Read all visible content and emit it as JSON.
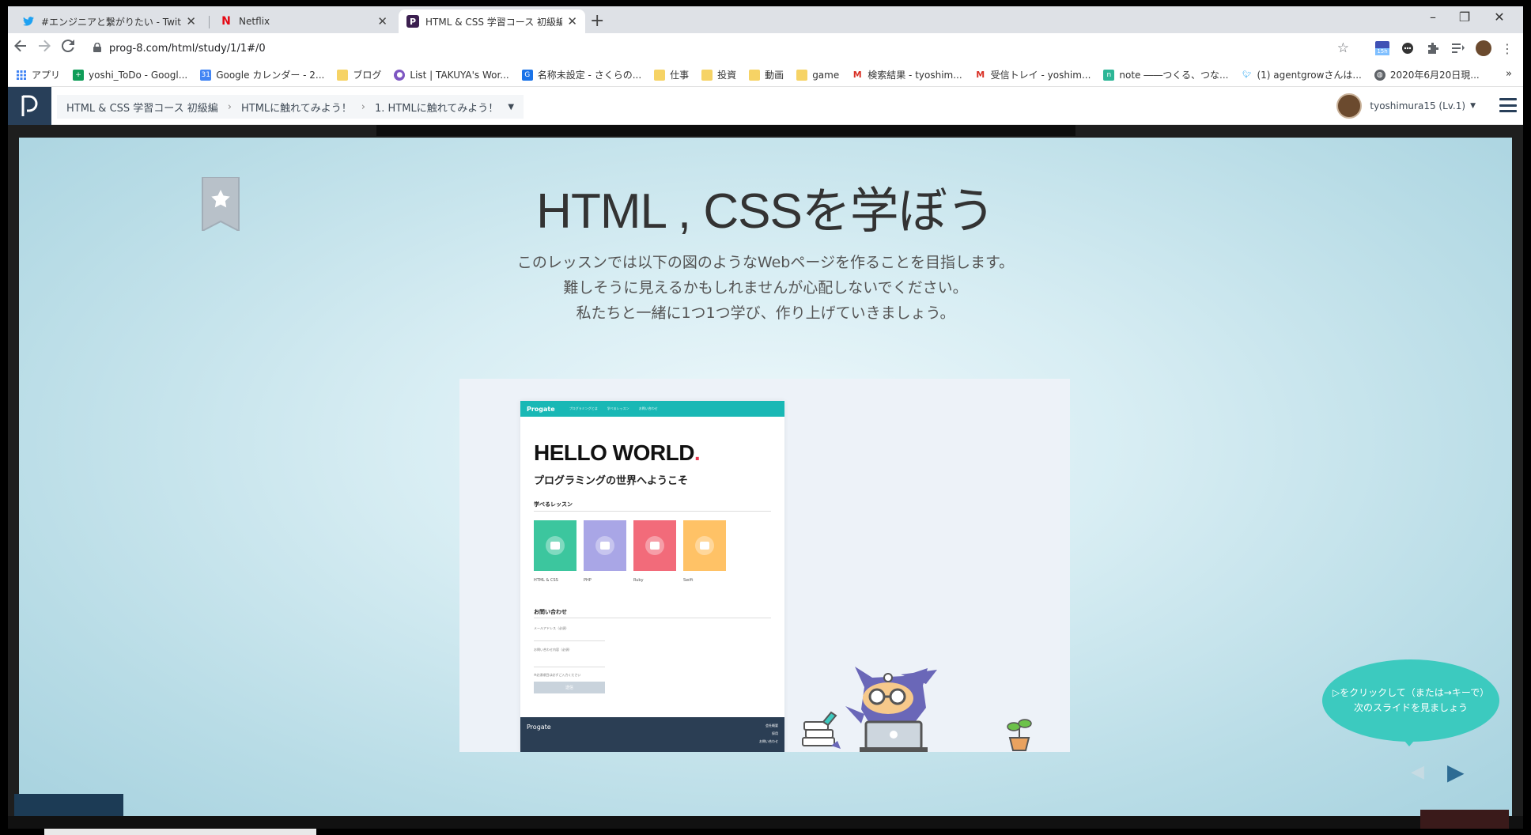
{
  "browser": {
    "tabs": [
      {
        "title": "#エンジニアと繋がりたい - Twitter検索",
        "favicon": "twitter",
        "active": false
      },
      {
        "title": "Netflix",
        "favicon": "netflix",
        "active": false
      },
      {
        "title": "HTML & CSS 学習コース 初級編 | プロゲート",
        "favicon": "progate",
        "active": true
      }
    ],
    "new_tab": "+",
    "window_controls": [
      "–",
      "❐",
      "✕"
    ],
    "url": "prog-8.com/html/study/1/1#/0",
    "extension_badge": "15h",
    "bookmarks": [
      {
        "label": "アプリ",
        "icon": "apps-grid-icon",
        "color": "#4285f4"
      },
      {
        "label": "yoshi_ToDo - Googl...",
        "icon": "sheets-icon",
        "color": "#0f9d58"
      },
      {
        "label": "Google カレンダー - 2...",
        "icon": "calendar-icon",
        "color": "#4285f4"
      },
      {
        "label": "ブログ",
        "icon": "folder-icon",
        "color": "#f6d365"
      },
      {
        "label": "List | TAKUYA's Wor...",
        "icon": "link-icon",
        "color": "#7e57c2"
      },
      {
        "label": "名称未設定 - さくらの...",
        "icon": "sakura-icon",
        "color": "#1a73e8"
      },
      {
        "label": "仕事",
        "icon": "folder-icon",
        "color": "#f6d365"
      },
      {
        "label": "投資",
        "icon": "folder-icon",
        "color": "#f6d365"
      },
      {
        "label": "動画",
        "icon": "folder-icon",
        "color": "#f6d365"
      },
      {
        "label": "game",
        "icon": "folder-icon",
        "color": "#f6d365"
      },
      {
        "label": "検索結果 - tyoshim...",
        "icon": "gmail-icon",
        "color": "#d93025"
      },
      {
        "label": "受信トレイ - yoshim...",
        "icon": "gmail-icon",
        "color": "#d93025"
      },
      {
        "label": "note ――つくる、つな...",
        "icon": "note-icon",
        "color": "#2cb696"
      },
      {
        "label": "(1) agentgrowさんは...",
        "icon": "twitter-icon",
        "color": "#1da1f2"
      },
      {
        "label": "2020年6月20日現...",
        "icon": "globe-icon",
        "color": "#5f6368"
      }
    ],
    "bookmarks_more": "»"
  },
  "progate": {
    "breadcrumb": [
      "HTML & CSS 学習コース 初級編",
      "HTMLに触れてみよう！",
      "1. HTMLに触れてみよう！"
    ],
    "username": "tyoshimura15 (Lv.1)"
  },
  "slide": {
    "title": "HTML , CSSを学ぼう",
    "description": [
      "このレッスンでは以下の図のようなWebページを作ることを目指します。",
      "難しそうに見えるかもしれませんが心配しないでください。",
      "私たちと一緒に1つ1つ学び、作り上げていきましょう。"
    ],
    "demo": {
      "brand": "Progate",
      "nav_links": [
        "プログラミングとは",
        "学べるレッスン",
        "お問い合わせ"
      ],
      "hello": "HELLO WORLD",
      "hello_dot": ".",
      "subtitle": "プログラミングの世界へようこそ",
      "lessons_heading": "学べるレッスン",
      "lessons": [
        {
          "label": "HTML & CSS",
          "color": "#3cc69e"
        },
        {
          "label": "PHP",
          "color": "#a9a6e6"
        },
        {
          "label": "Ruby",
          "color": "#f26b7a"
        },
        {
          "label": "Swift",
          "color": "#ffc266"
        }
      ],
      "contact_heading": "お問い合わせ",
      "form_labels": [
        "メールアドレス（必須）",
        "お問い合わせ内容（必須）",
        "※必須項目は必ずご入力ください"
      ],
      "submit_label": "送信",
      "footer_brand": "Progate",
      "footer_links": [
        "会社概要",
        "採用",
        "お問い合わせ"
      ]
    },
    "hint": [
      "▷をクリックして（または→キーで）",
      "次のスライドを見ましょう"
    ],
    "prev_arrow": "◀",
    "next_arrow": "▶"
  },
  "colors": {
    "progate_navy": "#283f59",
    "demo_teal": "#19b8b5",
    "hint_bubble": "#3ccabf"
  }
}
